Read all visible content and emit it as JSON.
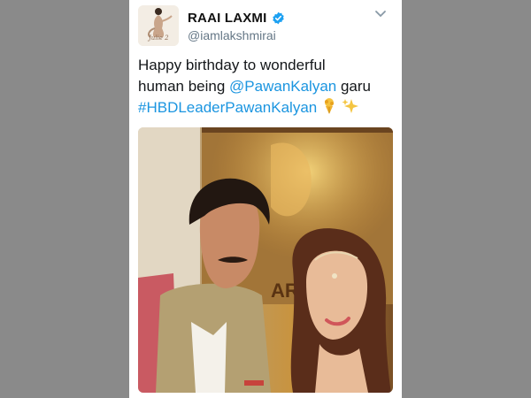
{
  "tweet": {
    "display_name": "RAAI LAXMI",
    "handle": "@iamlakshmirai",
    "text_line1": "Happy birthday to wonderful",
    "text_line2_prefix": "human being ",
    "mention": "@PawanKalyan",
    "text_line2_suffix": " garu",
    "hashtag": "#HBDLeaderPawanKalyan",
    "avatar_caption": "Julie 2"
  },
  "icons": {
    "verified": "verified-badge-icon",
    "menu": "chevron-down-icon",
    "emoji1": "bouquet-emoji-icon",
    "emoji2": "sparkles-emoji-icon"
  },
  "colors": {
    "link": "#1b95e0",
    "verified": "#1da1f2",
    "handle": "#657786",
    "backdrop": "#8a8a8a"
  }
}
